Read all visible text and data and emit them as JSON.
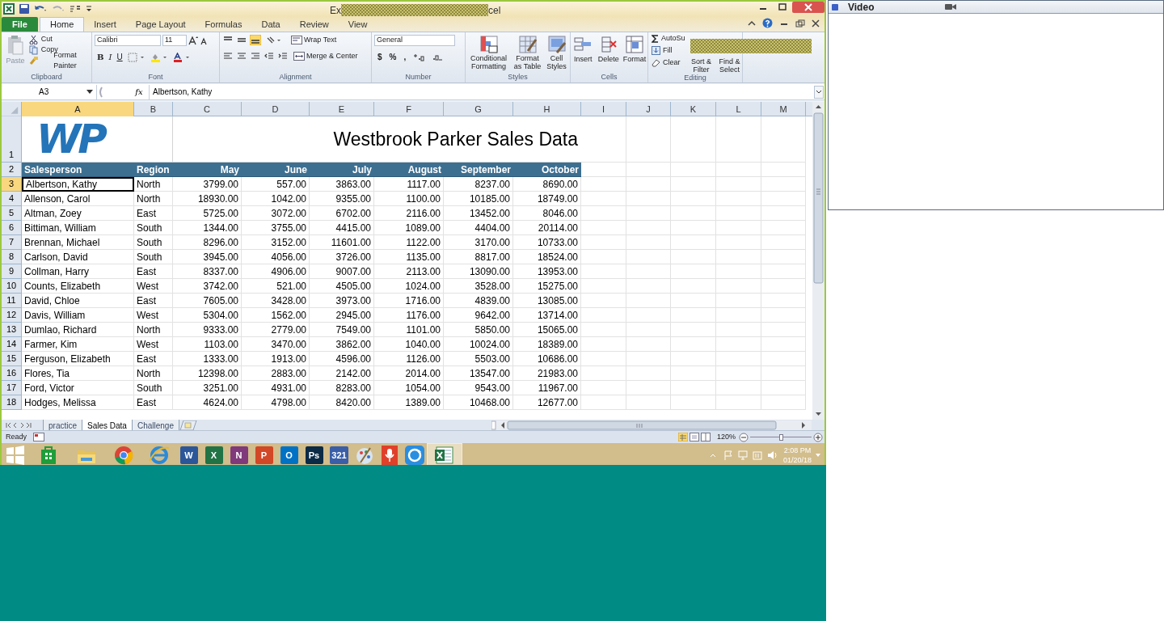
{
  "window": {
    "title_start": "Ex",
    "title_end": "cel"
  },
  "ribbon_tabs": [
    {
      "label": "File",
      "kind": "file"
    },
    {
      "label": "Home",
      "kind": "tab",
      "selected": true
    },
    {
      "label": "Insert",
      "kind": "tab",
      "selected": false
    },
    {
      "label": "Page Layout",
      "kind": "tab",
      "selected": false
    },
    {
      "label": "Formulas",
      "kind": "tab",
      "selected": false
    },
    {
      "label": "Data",
      "kind": "tab",
      "selected": false
    },
    {
      "label": "Review",
      "kind": "tab",
      "selected": false
    },
    {
      "label": "View",
      "kind": "tab",
      "selected": false
    }
  ],
  "ribbon": {
    "clipboard": {
      "label": "Clipboard",
      "paste": "Paste",
      "cut": "Cut",
      "copy": "Copy",
      "format_painter": "Format Painter"
    },
    "font": {
      "label": "Font",
      "font_name": "Calibri",
      "font_size": "11",
      "bold": "B",
      "italic": "I",
      "underline": "U"
    },
    "alignment": {
      "label": "Alignment",
      "wrap_text": "Wrap Text",
      "merge_center": "Merge & Center"
    },
    "number": {
      "label": "Number",
      "format": "General",
      "currency": "$",
      "percent": "%",
      "comma": ","
    },
    "styles": {
      "label": "Styles",
      "buttons": [
        "Conditional Formatting",
        "Format as Table",
        "Cell Styles"
      ]
    },
    "cells": {
      "label": "Cells",
      "buttons": [
        "Insert",
        "Delete",
        "Format"
      ]
    },
    "editing": {
      "label": "Editing",
      "autosum": "AutoSu",
      "fill": "Fill",
      "clear": "Clear",
      "sort_filter": "Sort & Filter",
      "find_select": "Find & Select"
    }
  },
  "formula_bar": {
    "name_box": "A3",
    "fx": "fx",
    "formula": "Albertson, Kathy"
  },
  "sheet": {
    "columns": [
      {
        "label": "A",
        "selected": true
      },
      {
        "label": "B",
        "selected": false
      },
      {
        "label": "C",
        "selected": false
      },
      {
        "label": "D",
        "selected": false
      },
      {
        "label": "E",
        "selected": false
      },
      {
        "label": "F",
        "selected": false
      },
      {
        "label": "G",
        "selected": false
      },
      {
        "label": "H",
        "selected": false
      },
      {
        "label": "I",
        "selected": false
      },
      {
        "label": "J",
        "selected": false
      },
      {
        "label": "K",
        "selected": false
      },
      {
        "label": "L",
        "selected": false
      },
      {
        "label": "M",
        "selected": false
      }
    ],
    "title_row": {
      "number": "1",
      "logo": "WP",
      "title": "Westbrook Parker Sales Data"
    },
    "header_row": {
      "number": "2",
      "cells": [
        "Salesperson",
        "Region",
        "May",
        "June",
        "July",
        "August",
        "September",
        "October"
      ]
    },
    "rows": [
      {
        "number": "3",
        "selected": true,
        "cells": [
          "Albertson, Kathy",
          "North",
          "3799.00",
          "557.00",
          "3863.00",
          "1117.00",
          "8237.00",
          "8690.00"
        ]
      },
      {
        "number": "4",
        "selected": false,
        "cells": [
          "Allenson, Carol",
          "North",
          "18930.00",
          "1042.00",
          "9355.00",
          "1100.00",
          "10185.00",
          "18749.00"
        ]
      },
      {
        "number": "5",
        "selected": false,
        "cells": [
          "Altman, Zoey",
          "East",
          "5725.00",
          "3072.00",
          "6702.00",
          "2116.00",
          "13452.00",
          "8046.00"
        ]
      },
      {
        "number": "6",
        "selected": false,
        "cells": [
          "Bittiman, William",
          "South",
          "1344.00",
          "3755.00",
          "4415.00",
          "1089.00",
          "4404.00",
          "20114.00"
        ]
      },
      {
        "number": "7",
        "selected": false,
        "cells": [
          "Brennan, Michael",
          "South",
          "8296.00",
          "3152.00",
          "11601.00",
          "1122.00",
          "3170.00",
          "10733.00"
        ]
      },
      {
        "number": "8",
        "selected": false,
        "cells": [
          "Carlson, David",
          "South",
          "3945.00",
          "4056.00",
          "3726.00",
          "1135.00",
          "8817.00",
          "18524.00"
        ]
      },
      {
        "number": "9",
        "selected": false,
        "cells": [
          "Collman, Harry",
          "East",
          "8337.00",
          "4906.00",
          "9007.00",
          "2113.00",
          "13090.00",
          "13953.00"
        ]
      },
      {
        "number": "10",
        "selected": false,
        "cells": [
          "Counts, Elizabeth",
          "West",
          "3742.00",
          "521.00",
          "4505.00",
          "1024.00",
          "3528.00",
          "15275.00"
        ]
      },
      {
        "number": "11",
        "selected": false,
        "cells": [
          "David, Chloe",
          "East",
          "7605.00",
          "3428.00",
          "3973.00",
          "1716.00",
          "4839.00",
          "13085.00"
        ]
      },
      {
        "number": "12",
        "selected": false,
        "cells": [
          "Davis, William",
          "West",
          "5304.00",
          "1562.00",
          "2945.00",
          "1176.00",
          "9642.00",
          "13714.00"
        ]
      },
      {
        "number": "13",
        "selected": false,
        "cells": [
          "Dumlao, Richard",
          "North",
          "9333.00",
          "2779.00",
          "7549.00",
          "1101.00",
          "5850.00",
          "15065.00"
        ]
      },
      {
        "number": "14",
        "selected": false,
        "cells": [
          "Farmer, Kim",
          "West",
          "1103.00",
          "3470.00",
          "3862.00",
          "1040.00",
          "10024.00",
          "18389.00"
        ]
      },
      {
        "number": "15",
        "selected": false,
        "cells": [
          "Ferguson, Elizabeth",
          "East",
          "1333.00",
          "1913.00",
          "4596.00",
          "1126.00",
          "5503.00",
          "10686.00"
        ]
      },
      {
        "number": "16",
        "selected": false,
        "cells": [
          "Flores, Tia",
          "North",
          "12398.00",
          "2883.00",
          "2142.00",
          "2014.00",
          "13547.00",
          "21983.00"
        ]
      },
      {
        "number": "17",
        "selected": false,
        "cells": [
          "Ford, Victor",
          "South",
          "3251.00",
          "4931.00",
          "8283.00",
          "1054.00",
          "9543.00",
          "11967.00"
        ]
      },
      {
        "number": "18",
        "selected": false,
        "cells": [
          "Hodges, Melissa",
          "East",
          "4624.00",
          "4798.00",
          "8420.00",
          "1389.00",
          "10468.00",
          "12677.00"
        ]
      }
    ],
    "sheet_tabs": [
      {
        "label": "practice",
        "selected": false
      },
      {
        "label": "Sales Data",
        "selected": true
      },
      {
        "label": "Challenge",
        "selected": false
      }
    ]
  },
  "status_bar": {
    "status": "Ready",
    "zoom": "120%",
    "zoom_slider": {
      "level": 0.5
    }
  },
  "taskbar": {
    "apps": [
      {
        "kind": "windows"
      },
      {
        "kind": "store"
      },
      {
        "kind": "folder"
      },
      {
        "kind": "chrome"
      },
      {
        "kind": "ie"
      },
      {
        "kind": "tile",
        "glyph": "W",
        "color": "#2b579a"
      },
      {
        "kind": "tile",
        "glyph": "X",
        "color": "#217346"
      },
      {
        "kind": "tile",
        "glyph": "N",
        "color": "#80397b"
      },
      {
        "kind": "tile",
        "glyph": "P",
        "color": "#d24726"
      },
      {
        "kind": "tile",
        "glyph": "O",
        "color": "#0072c6"
      },
      {
        "kind": "tile",
        "glyph": "Ps",
        "color": "#0b2a45"
      },
      {
        "kind": "tile",
        "glyph": "321",
        "color": "#3a5fa8"
      },
      {
        "kind": "paint"
      },
      {
        "kind": "mic"
      },
      {
        "kind": "sync"
      },
      {
        "kind": "excel",
        "selected": true
      }
    ],
    "time": "2:08 PM",
    "date": "01/20/18"
  },
  "video_panel": {
    "title": "Video"
  }
}
